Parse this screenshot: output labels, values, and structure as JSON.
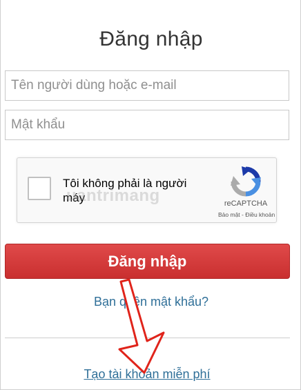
{
  "colors": {
    "login_button": "#d33b3b",
    "link": "#2f6f98",
    "arrow": "#e0241b"
  },
  "form": {
    "title": "Đăng nhập",
    "username_placeholder": "Tên người dùng hoặc e-mail",
    "password_placeholder": "Mật khẩu"
  },
  "captcha": {
    "label": "Tôi không phải là người máy",
    "brand": "reCAPTCHA",
    "links": "Bảo mật - Điều khoản",
    "icon": "recaptcha-icon",
    "checked": false
  },
  "actions": {
    "login_label": "Đăng nhập",
    "forgot_password": "Bạn quên mật khẩu?",
    "create_account": "Tạo tài khoản miễn phí"
  },
  "watermark": "uantrimang"
}
